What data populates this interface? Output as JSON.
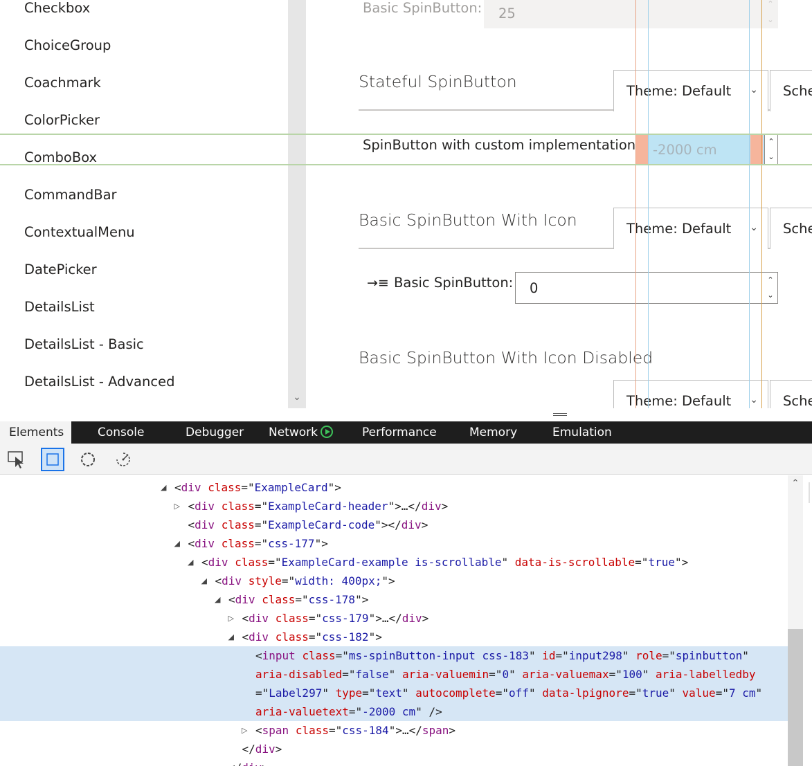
{
  "nav": {
    "items": [
      "Checkbox",
      "ChoiceGroup",
      "Coachmark",
      "ColorPicker",
      "ComboBox",
      "CommandBar",
      "ContextualMenu",
      "DatePicker",
      "DetailsList",
      "DetailsList - Basic",
      "DetailsList - Advanced"
    ]
  },
  "main": {
    "top_spin": {
      "label": "Basic SpinButton:",
      "value": "25"
    },
    "sections": [
      {
        "title": "Stateful SpinButton",
        "theme": "Theme: Default",
        "scheme": "Sche"
      },
      {
        "title": "Basic SpinButton With Icon",
        "theme": "Theme: Default",
        "scheme": "Sche"
      },
      {
        "title": "Basic SpinButton With Icon Disabled",
        "theme": "Theme: Default",
        "scheme": "Sche"
      }
    ],
    "custom_spin": {
      "label": "SpinButton with custom implementation:",
      "value": "-2000 cm"
    },
    "icon_spin": {
      "label": "Basic SpinButton:",
      "value": "0"
    }
  },
  "devtools": {
    "tabs": [
      "Elements",
      "Console",
      "Debugger",
      "Network",
      "Performance",
      "Memory",
      "Emulation"
    ],
    "tools": [
      "select-element-icon",
      "box-model-icon",
      "color-picker-icon",
      "accessibility-icon"
    ],
    "lines": [
      {
        "tri": "open",
        "indent": 0,
        "parts": [
          [
            "br",
            "<"
          ],
          [
            "tag",
            "div"
          ],
          [
            "sp",
            " "
          ],
          [
            "attr",
            "class"
          ],
          [
            "br",
            "=\""
          ],
          [
            "val",
            "ExampleCard"
          ],
          [
            "br",
            "\">"
          ]
        ]
      },
      {
        "tri": "closed",
        "indent": 1,
        "parts": [
          [
            "br",
            "<"
          ],
          [
            "tag",
            "div"
          ],
          [
            "sp",
            " "
          ],
          [
            "attr",
            "class"
          ],
          [
            "br",
            "=\""
          ],
          [
            "val",
            "ExampleCard-header"
          ],
          [
            "br",
            "\">…</"
          ],
          [
            "tag",
            "div"
          ],
          [
            "br",
            ">"
          ]
        ]
      },
      {
        "tri": "none",
        "indent": 1,
        "parts": [
          [
            "br",
            "<"
          ],
          [
            "tag",
            "div"
          ],
          [
            "sp",
            " "
          ],
          [
            "attr",
            "class"
          ],
          [
            "br",
            "=\""
          ],
          [
            "val",
            "ExampleCard-code"
          ],
          [
            "br",
            "\"></"
          ],
          [
            "tag",
            "div"
          ],
          [
            "br",
            ">"
          ]
        ]
      },
      {
        "tri": "open",
        "indent": 1,
        "parts": [
          [
            "br",
            "<"
          ],
          [
            "tag",
            "div"
          ],
          [
            "sp",
            " "
          ],
          [
            "attr",
            "class"
          ],
          [
            "br",
            "=\""
          ],
          [
            "val",
            "css-177"
          ],
          [
            "br",
            "\">"
          ]
        ]
      },
      {
        "tri": "open",
        "indent": 2,
        "parts": [
          [
            "br",
            "<"
          ],
          [
            "tag",
            "div"
          ],
          [
            "sp",
            " "
          ],
          [
            "attr",
            "class"
          ],
          [
            "br",
            "=\""
          ],
          [
            "val",
            "ExampleCard-example is-scrollable"
          ],
          [
            "br",
            "\" "
          ],
          [
            "attr",
            "data-is-scrollable"
          ],
          [
            "br",
            "=\""
          ],
          [
            "val",
            "true"
          ],
          [
            "br",
            "\">"
          ]
        ]
      },
      {
        "tri": "open",
        "indent": 3,
        "parts": [
          [
            "br",
            "<"
          ],
          [
            "tag",
            "div"
          ],
          [
            "sp",
            " "
          ],
          [
            "attr",
            "style"
          ],
          [
            "br",
            "=\""
          ],
          [
            "val",
            "width: 400px;"
          ],
          [
            "br",
            "\">"
          ]
        ]
      },
      {
        "tri": "open",
        "indent": 4,
        "parts": [
          [
            "br",
            "<"
          ],
          [
            "tag",
            "div"
          ],
          [
            "sp",
            " "
          ],
          [
            "attr",
            "class"
          ],
          [
            "br",
            "=\""
          ],
          [
            "val",
            "css-178"
          ],
          [
            "br",
            "\">"
          ]
        ]
      },
      {
        "tri": "closed",
        "indent": 5,
        "parts": [
          [
            "br",
            "<"
          ],
          [
            "tag",
            "div"
          ],
          [
            "sp",
            " "
          ],
          [
            "attr",
            "class"
          ],
          [
            "br",
            "=\""
          ],
          [
            "val",
            "css-179"
          ],
          [
            "br",
            "\">…</"
          ],
          [
            "tag",
            "div"
          ],
          [
            "br",
            ">"
          ]
        ]
      },
      {
        "tri": "open",
        "indent": 5,
        "parts": [
          [
            "br",
            "<"
          ],
          [
            "tag",
            "div"
          ],
          [
            "sp",
            " "
          ],
          [
            "attr",
            "class"
          ],
          [
            "br",
            "=\""
          ],
          [
            "val",
            "css-182"
          ],
          [
            "br",
            "\">"
          ]
        ]
      },
      {
        "tri": "none",
        "indent": 6,
        "hl": true,
        "parts": [
          [
            "br",
            "<"
          ],
          [
            "tag",
            "input"
          ],
          [
            "sp",
            " "
          ],
          [
            "attr",
            "class"
          ],
          [
            "br",
            "=\""
          ],
          [
            "val",
            "ms-spinButton-input css-183"
          ],
          [
            "br",
            "\" "
          ],
          [
            "attr",
            "id"
          ],
          [
            "br",
            "=\""
          ],
          [
            "val",
            "input298"
          ],
          [
            "br",
            "\" "
          ],
          [
            "attr",
            "role"
          ],
          [
            "br",
            "=\""
          ],
          [
            "val",
            "spinbutton"
          ],
          [
            "br",
            "\""
          ]
        ]
      },
      {
        "tri": "none",
        "indent": 6,
        "hl": true,
        "parts": [
          [
            "attr",
            "aria-disabled"
          ],
          [
            "br",
            "=\""
          ],
          [
            "val",
            "false"
          ],
          [
            "br",
            "\" "
          ],
          [
            "attr",
            "aria-valuemin"
          ],
          [
            "br",
            "=\""
          ],
          [
            "val",
            "0"
          ],
          [
            "br",
            "\" "
          ],
          [
            "attr",
            "aria-valuemax"
          ],
          [
            "br",
            "=\""
          ],
          [
            "val",
            "100"
          ],
          [
            "br",
            "\" "
          ],
          [
            "attr",
            "aria-labelledby"
          ]
        ]
      },
      {
        "tri": "none",
        "indent": 6,
        "hl": true,
        "parts": [
          [
            "br",
            "=\""
          ],
          [
            "val",
            "Label297"
          ],
          [
            "br",
            "\" "
          ],
          [
            "attr",
            "type"
          ],
          [
            "br",
            "=\""
          ],
          [
            "val",
            "text"
          ],
          [
            "br",
            "\" "
          ],
          [
            "attr",
            "autocomplete"
          ],
          [
            "br",
            "=\""
          ],
          [
            "val",
            "off"
          ],
          [
            "br",
            "\" "
          ],
          [
            "attr",
            "data-lpignore"
          ],
          [
            "br",
            "=\""
          ],
          [
            "val",
            "true"
          ],
          [
            "br",
            "\" "
          ],
          [
            "attr",
            "value"
          ],
          [
            "br",
            "=\""
          ],
          [
            "val",
            "7 cm"
          ],
          [
            "br",
            "\""
          ]
        ]
      },
      {
        "tri": "none",
        "indent": 6,
        "hl": true,
        "parts": [
          [
            "attr",
            "aria-valuetext"
          ],
          [
            "br",
            "=\""
          ],
          [
            "val",
            "-2000 cm"
          ],
          [
            "br",
            "\" />"
          ]
        ]
      },
      {
        "tri": "closed",
        "indent": 6,
        "parts": [
          [
            "br",
            "<"
          ],
          [
            "tag",
            "span"
          ],
          [
            "sp",
            " "
          ],
          [
            "attr",
            "class"
          ],
          [
            "br",
            "=\""
          ],
          [
            "val",
            "css-184"
          ],
          [
            "br",
            "\">…</"
          ],
          [
            "tag",
            "span"
          ],
          [
            "br",
            ">"
          ]
        ]
      },
      {
        "tri": "none",
        "indent": 5,
        "parts": [
          [
            "br",
            "</"
          ],
          [
            "tag",
            "div"
          ],
          [
            "br",
            ">"
          ]
        ]
      },
      {
        "tri": "none",
        "indent": 4,
        "parts": [
          [
            "br",
            "</"
          ],
          [
            "tag",
            "div"
          ],
          [
            "br",
            ">"
          ]
        ]
      }
    ]
  }
}
